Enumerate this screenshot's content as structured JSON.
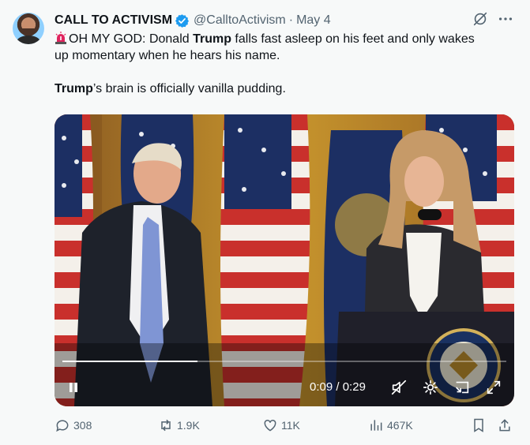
{
  "tweet": {
    "display_name": "CALL TO ACTIVISM",
    "handle": "@CalltoActivism",
    "separator": "·",
    "date": "May 4",
    "text": {
      "line1_pre": "OH MY GOD: Donald ",
      "line1_bold": "Trump",
      "line1_post": " falls fast asleep on his feet and only wakes",
      "line2": "up momentary when he hears his name.",
      "line3_bold": "Trump",
      "line3_post": "’s brain is officially vanilla pudding."
    },
    "emoji": "siren-emoji",
    "verified_color": "#1d9bf0"
  },
  "video": {
    "current_time": "0:09",
    "time_separator": " / ",
    "duration": "0:29",
    "progress_fraction": 0.305,
    "seal_text": "PRESIDENT OF THE UNITED STATES"
  },
  "actions": {
    "replies": "308",
    "reposts": "1.9K",
    "likes": "11K",
    "views": "467K"
  },
  "icons": [
    "grok-icon",
    "more-icon",
    "pause-icon",
    "mute-icon",
    "settings-icon",
    "pip-icon",
    "fullscreen-icon",
    "reply-icon",
    "repost-icon",
    "like-icon",
    "views-icon",
    "bookmark-icon",
    "share-icon"
  ],
  "colors": {
    "text": "#0f1419",
    "muted": "#536471",
    "background": "#f7f9f9"
  }
}
